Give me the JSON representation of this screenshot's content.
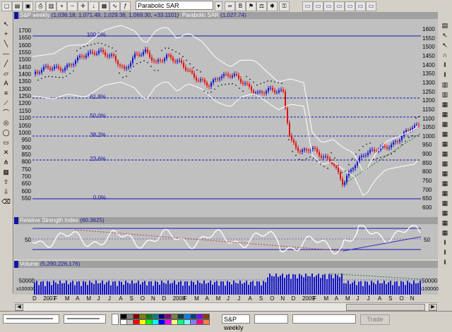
{
  "toolbar": {
    "indicator_select": "Parabolic SAR",
    "icons": [
      "new-icon",
      "open-icon",
      "save-icon",
      "print-icon",
      "chart-icon",
      "zoom-in-icon",
      "zoom-out-icon",
      "crosshair-icon",
      "grid-icon",
      "layout-icon",
      "window-icon",
      "tile-icon"
    ]
  },
  "price_pane": {
    "title": "S&P weekly",
    "ohlc": "(1,036.18, 1,071.48, 1,029.38, 1,069.30, +33.1101)",
    "indicator": "Parabolic SAR",
    "indicator_value": "(1,027.74)",
    "left_axis": [
      "1700",
      "1650",
      "1600",
      "1550",
      "1500",
      "1450",
      "1400",
      "1350",
      "1300",
      "1250",
      "1200",
      "1150",
      "1100",
      "1050",
      "1000",
      "950",
      "900",
      "850",
      "800",
      "750",
      "700",
      "650",
      "600",
      "550"
    ],
    "right_axis": [
      "1600",
      "1550",
      "1500",
      "1450",
      "1400",
      "1350",
      "1300",
      "1250",
      "1200",
      "1150",
      "1100",
      "1050",
      "1000",
      "950",
      "900",
      "850",
      "800",
      "750",
      "700",
      "650",
      "600"
    ],
    "fib_levels": [
      "100.0%",
      "61.8%",
      "50.0%",
      "38.2%",
      "23.6%",
      "0.0%"
    ]
  },
  "rsi_pane": {
    "title": "Relative Strength Index",
    "value": "(60.3625)",
    "axis_left": "50",
    "axis_right": "50"
  },
  "volume_pane": {
    "title": "Volume",
    "value": "(5,290,226,176)",
    "axis_left": "50000",
    "axis_right": "50000",
    "multiplier": "x100000"
  },
  "x_axis": {
    "labels": [
      "D",
      "2007",
      "F",
      "M",
      "A",
      "M",
      "J",
      "J",
      "A",
      "S",
      "O",
      "N",
      "D",
      "2008",
      "F",
      "M",
      "A",
      "M",
      "J",
      "J",
      "A",
      "S",
      "O",
      "N",
      "D",
      "2009",
      "F",
      "M",
      "A",
      "M",
      "J",
      "J",
      "A",
      "S",
      "O",
      "N"
    ]
  },
  "bottom": {
    "symbol": "S&P weekly",
    "trade_button": "Trade"
  },
  "colors": {
    "up_bar": "#1414c8",
    "down_bar": "#e01010",
    "pane_bg": "#c0c0c0",
    "fib_line": "#1414b4",
    "sar": "#000000"
  }
}
